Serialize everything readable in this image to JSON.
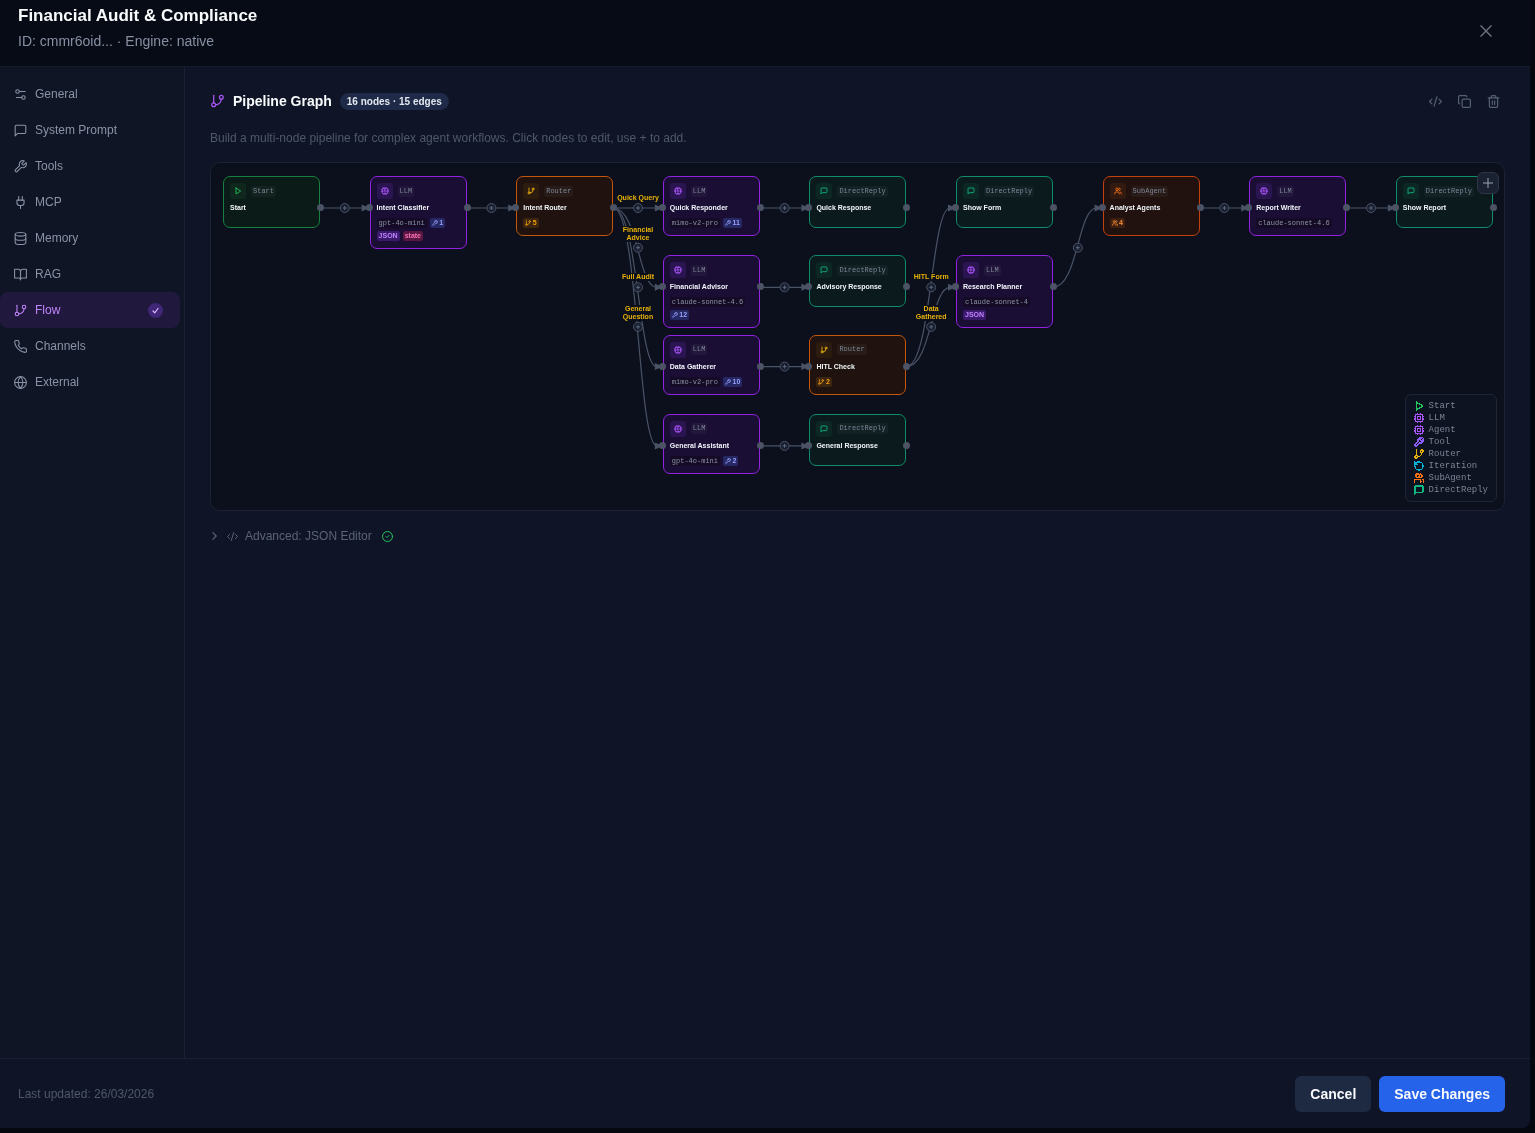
{
  "header": {
    "title": "Financial Audit & Compliance",
    "subtitle": "ID: cmmr6oid... · Engine: native"
  },
  "sidebar": {
    "items": [
      {
        "label": "General",
        "selected": false,
        "complete": false
      },
      {
        "label": "System Prompt",
        "selected": false,
        "complete": false
      },
      {
        "label": "Tools",
        "selected": false,
        "complete": false
      },
      {
        "label": "MCP",
        "selected": false,
        "complete": false
      },
      {
        "label": "Memory",
        "selected": false,
        "complete": false
      },
      {
        "label": "RAG",
        "selected": false,
        "complete": false
      },
      {
        "label": "Flow",
        "selected": true,
        "complete": true
      },
      {
        "label": "Channels",
        "selected": false,
        "complete": false
      },
      {
        "label": "External",
        "selected": false,
        "complete": false
      }
    ]
  },
  "pipeline": {
    "title": "Pipeline Graph",
    "stats": "16 nodes · 15 edges",
    "description": "Build a multi-node pipeline for complex agent workflows. Click nodes to edit, use + to add.",
    "graph": {
      "root": {
        "kind": "start",
        "tag": "Start",
        "title": "Start",
        "children": [
          {
            "kind": "llm",
            "tag": "LLM",
            "title": "Intent Classifier",
            "badges": [
              {
                "kind": "model",
                "text": "gpt-4o-mini"
              },
              {
                "kind": "tools",
                "text": "1"
              },
              {
                "kind": "format",
                "text": "JSON"
              },
              {
                "kind": "state",
                "text": "state"
              }
            ],
            "children": [
              {
                "kind": "router",
                "tag": "Router",
                "title": "Intent Router",
                "badges": [
                  {
                    "kind": "routes",
                    "text": "5"
                  }
                ],
                "children": [
                  {
                    "route": "Quick Query",
                    "kind": "llm",
                    "tag": "LLM",
                    "title": "Quick Responder",
                    "badges": [
                      {
                        "kind": "model",
                        "text": "mimo-v2-pro"
                      },
                      {
                        "kind": "tools",
                        "text": "11"
                      }
                    ],
                    "children": [
                      {
                        "kind": "directreply",
                        "tag": "DirectReply",
                        "title": "Quick Response"
                      }
                    ]
                  },
                  {
                    "route": "Financial Advice",
                    "kind": "llm",
                    "tag": "LLM",
                    "title": "Financial Advisor",
                    "badges": [
                      {
                        "kind": "model",
                        "text": "claude-sonnet-4.6"
                      },
                      {
                        "kind": "tools",
                        "text": "12"
                      }
                    ],
                    "children": [
                      {
                        "kind": "directreply",
                        "tag": "DirectReply",
                        "title": "Advisory Response"
                      }
                    ]
                  },
                  {
                    "route": "Full Audit",
                    "kind": "llm",
                    "tag": "LLM",
                    "title": "Data Gatherer",
                    "badges": [
                      {
                        "kind": "model",
                        "text": "mimo-v2-pro"
                      },
                      {
                        "kind": "tools",
                        "text": "10"
                      }
                    ],
                    "children": [
                      {
                        "kind": "router",
                        "tag": "Router",
                        "title": "HITL Check",
                        "badges": [
                          {
                            "kind": "routes",
                            "text": "2"
                          }
                        ],
                        "children": [
                          {
                            "route": "HITL Form",
                            "kind": "directreply",
                            "tag": "DirectReply",
                            "title": "Show Form"
                          },
                          {
                            "route": "Data Gathered",
                            "kind": "llm",
                            "tag": "LLM",
                            "title": "Research Planner",
                            "badges": [
                              {
                                "kind": "model",
                                "text": "claude-sonnet-4"
                              },
                              {
                                "kind": "format",
                                "text": "JSON"
                              }
                            ],
                            "children": [
                              {
                                "kind": "subagent",
                                "tag": "SubAgent",
                                "title": "Analyst Agents",
                                "badges": [
                                  {
                                    "kind": "agents",
                                    "text": "4"
                                  }
                                ],
                                "children": [
                                  {
                                    "kind": "llm",
                                    "tag": "LLM",
                                    "title": "Report Writer",
                                    "badges": [
                                      {
                                        "kind": "model",
                                        "text": "claude-sonnet-4.6"
                                      }
                                    ],
                                    "children": [
                                      {
                                        "kind": "directreply",
                                        "tag": "DirectReply",
                                        "title": "Show Report"
                                      }
                                    ]
                                  }
                                ]
                              }
                            ]
                          }
                        ]
                      }
                    ]
                  },
                  {
                    "route": "General Question",
                    "kind": "llm",
                    "tag": "LLM",
                    "title": "General Assistant",
                    "badges": [
                      {
                        "kind": "model",
                        "text": "gpt-4o-mini"
                      },
                      {
                        "kind": "tools",
                        "text": "2"
                      }
                    ],
                    "children": [
                      {
                        "kind": "directreply",
                        "tag": "DirectReply",
                        "title": "General Response"
                      }
                    ]
                  }
                ]
              }
            ]
          }
        ]
      },
      "legend": [
        {
          "kind": "start",
          "label": "Start",
          "color": "#22c55e"
        },
        {
          "kind": "llm",
          "label": "LLM",
          "color": "#a855f7"
        },
        {
          "kind": "agent",
          "label": "Agent",
          "color": "#a855f7"
        },
        {
          "kind": "tool",
          "label": "Tool",
          "color": "#8b5cf6"
        },
        {
          "kind": "router",
          "label": "Router",
          "color": "#eab308"
        },
        {
          "kind": "iteration",
          "label": "Iteration",
          "color": "#06b6d4"
        },
        {
          "kind": "subagent",
          "label": "SubAgent",
          "color": "#f97316"
        },
        {
          "kind": "directreply",
          "label": "DirectReply",
          "color": "#10b981"
        }
      ]
    }
  },
  "json_editor": {
    "label": "Advanced: JSON Editor",
    "expanded": false,
    "valid": true
  },
  "footer": {
    "last_updated": "Last updated: 26/03/2026",
    "buttons": [
      {
        "label": "Cancel",
        "kind": "secondary"
      },
      {
        "label": "Save Changes",
        "kind": "primary"
      }
    ]
  }
}
